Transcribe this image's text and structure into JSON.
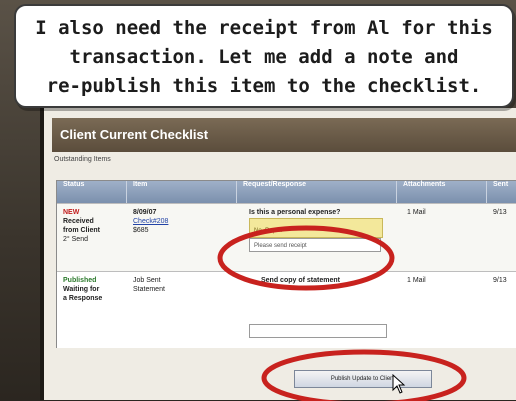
{
  "callout": {
    "lines": [
      "I also need the receipt from Al for this",
      "transaction. Let me add a note and",
      "re-publish this item to the checklist."
    ]
  },
  "window": {
    "title": "Client Current Checklist",
    "subnav": "Outstanding Items"
  },
  "table": {
    "headers": [
      "Status",
      "Item",
      "Request/Response",
      "Attachments",
      "Sent"
    ],
    "rows": [
      {
        "status": [
          "NEW",
          "Received",
          "from Client",
          "2° Send"
        ],
        "item": [
          "8/09/07",
          "Check#208",
          "$685"
        ],
        "request": "Is this a personal expense?",
        "request_note": "No. Repair",
        "reply_input": "Please send receipt",
        "attachments": "1 Mail",
        "sent": "9/13"
      },
      {
        "status": [
          "Published",
          "Waiting for",
          "a Response"
        ],
        "item": [
          "Job Sent",
          "Statement"
        ],
        "request": "Send copy of statement",
        "attachments": "1 Mail",
        "sent": "9/13"
      }
    ]
  },
  "publish_button": "Publish Update to Client",
  "colors": {
    "highlight_ellipse": "#c8221e",
    "header_bar": "#7b90ad",
    "title_bar": "#5b4d3c"
  }
}
